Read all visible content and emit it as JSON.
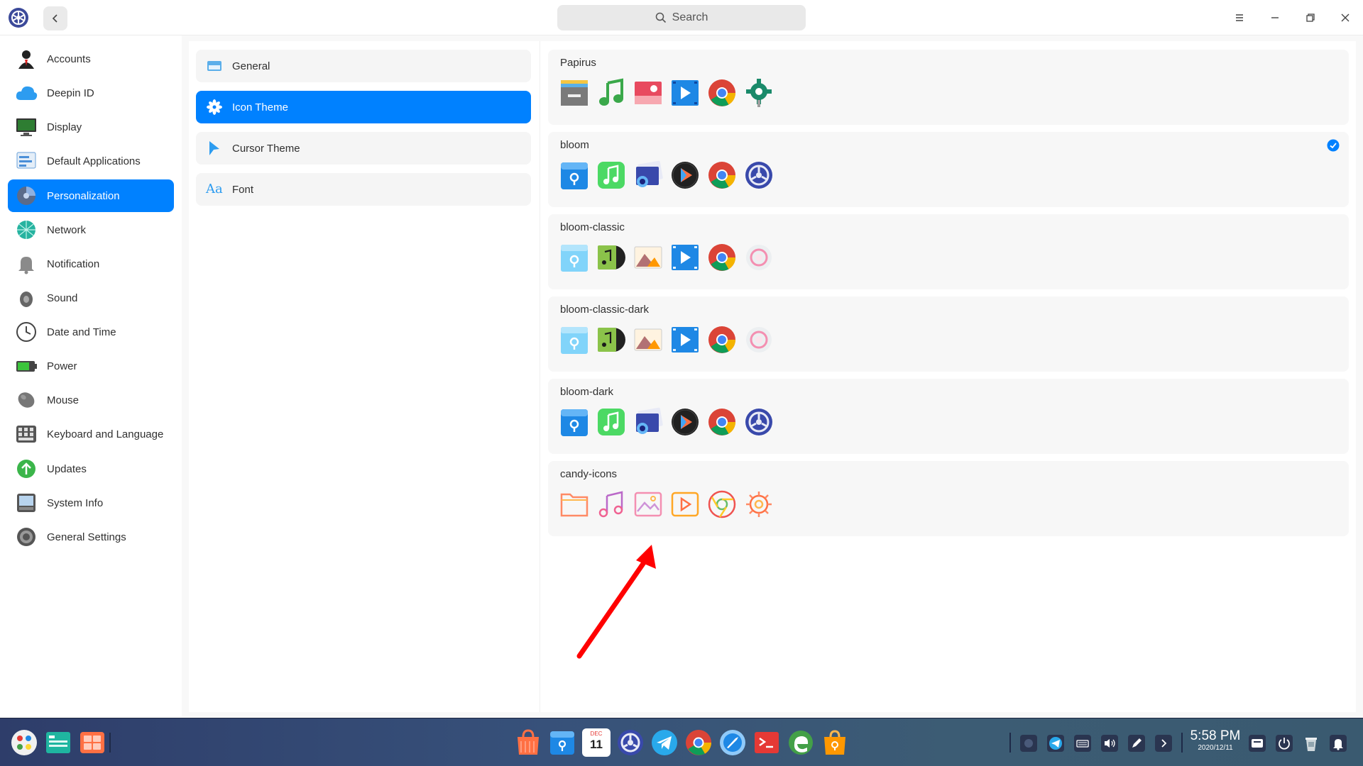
{
  "titlebar": {
    "search_placeholder": "Search"
  },
  "nav": {
    "items": [
      {
        "label": "Accounts",
        "icon": "accounts-icon"
      },
      {
        "label": "Deepin ID",
        "icon": "cloud-icon"
      },
      {
        "label": "Display",
        "icon": "display-icon"
      },
      {
        "label": "Default Applications",
        "icon": "default-apps-icon"
      },
      {
        "label": "Personalization",
        "icon": "personalization-icon",
        "active": true
      },
      {
        "label": "Network",
        "icon": "network-icon"
      },
      {
        "label": "Notification",
        "icon": "bell-icon"
      },
      {
        "label": "Sound",
        "icon": "speaker-icon"
      },
      {
        "label": "Date and Time",
        "icon": "clock-icon"
      },
      {
        "label": "Power",
        "icon": "battery-icon"
      },
      {
        "label": "Mouse",
        "icon": "mouse-icon"
      },
      {
        "label": "Keyboard and Language",
        "icon": "keyboard-icon"
      },
      {
        "label": "Updates",
        "icon": "update-arrow-icon"
      },
      {
        "label": "System Info",
        "icon": "system-info-icon"
      },
      {
        "label": "General Settings",
        "icon": "gear-icon"
      }
    ]
  },
  "personalization": {
    "items": [
      {
        "label": "General",
        "icon": "window-icon"
      },
      {
        "label": "Icon Theme",
        "icon": "flower-icon",
        "active": true
      },
      {
        "label": "Cursor Theme",
        "icon": "cursor-icon"
      },
      {
        "label": "Font",
        "icon": "font-icon",
        "glyph": "Aa"
      }
    ]
  },
  "themes": [
    {
      "name": "Papirus",
      "selected": false
    },
    {
      "name": "bloom",
      "selected": true
    },
    {
      "name": "bloom-classic",
      "selected": false
    },
    {
      "name": "bloom-classic-dark",
      "selected": false
    },
    {
      "name": "bloom-dark",
      "selected": false
    },
    {
      "name": "candy-icons",
      "selected": false
    }
  ],
  "dock": {
    "time": "5:58 PM",
    "date": "2020/12/11",
    "calendar_month": "DEC",
    "calendar_day": "11"
  },
  "colors": {
    "accent": "#0081ff",
    "arrow": "#ff0000"
  }
}
